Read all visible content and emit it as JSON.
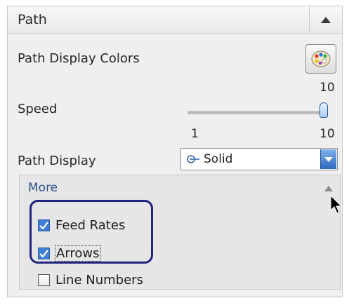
{
  "panel": {
    "title": "Path",
    "path_display_colors_label": "Path Display Colors",
    "speed": {
      "label": "Speed",
      "value": "10",
      "min": "1",
      "max": "10"
    },
    "path_display": {
      "label": "Path Display",
      "selected": "Solid"
    },
    "more": {
      "label": "More",
      "options": [
        {
          "label": "Feed Rates",
          "checked": true
        },
        {
          "label": "Arrows",
          "checked": true
        },
        {
          "label": "Line Numbers",
          "checked": false
        }
      ]
    }
  },
  "colors": {
    "accent": "#3f80d8",
    "highlight_outline": "#1f237e",
    "more_link": "#2d4f86"
  },
  "icons": [
    "chevron-up-icon",
    "palette-icon",
    "chevron-down-icon",
    "solid-line-icon",
    "checkmark-icon",
    "mouse-cursor-icon"
  ]
}
